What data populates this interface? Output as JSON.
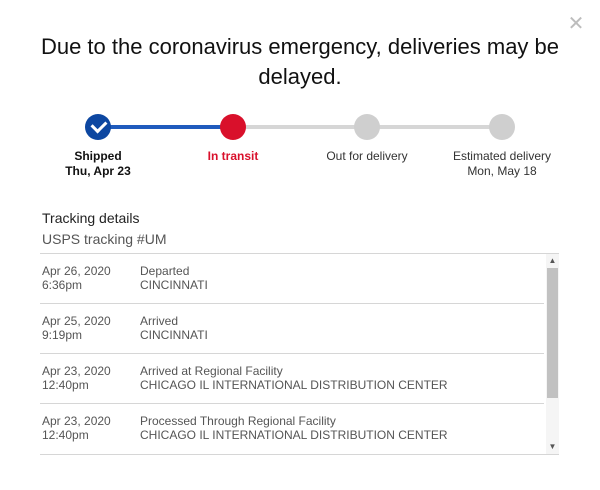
{
  "close": {
    "glyph": "✕"
  },
  "headline": "Due to the coronavirus emergency, deliveries may be delayed.",
  "progress": {
    "colors": {
      "done": "#0d47a1",
      "current": "#d9102b",
      "future": "#cfcfcf"
    },
    "steps": [
      {
        "label": "Shipped",
        "sub": "Thu, Apr 23",
        "state": "done"
      },
      {
        "label": "In transit",
        "sub": "",
        "state": "current"
      },
      {
        "label": "Out for delivery",
        "sub": "",
        "state": "future"
      },
      {
        "label": "Estimated delivery",
        "sub": "Mon, May 18",
        "state": "future"
      }
    ]
  },
  "tracking": {
    "title": "Tracking details",
    "number": "USPS tracking #UM",
    "events": [
      {
        "date": "Apr 26, 2020",
        "time": "6:36pm",
        "status": "Departed",
        "location": "CINCINNATI"
      },
      {
        "date": "Apr 25, 2020",
        "time": "9:19pm",
        "status": "Arrived",
        "location": "CINCINNATI"
      },
      {
        "date": "Apr 23, 2020",
        "time": "12:40pm",
        "status": "Arrived at Regional Facility",
        "location": "CHICAGO IL INTERNATIONAL DISTRIBUTION CENTER"
      },
      {
        "date": "Apr 23, 2020",
        "time": "12:40pm",
        "status": "Processed Through Regional Facility",
        "location": "CHICAGO IL INTERNATIONAL DISTRIBUTION CENTER"
      }
    ]
  }
}
